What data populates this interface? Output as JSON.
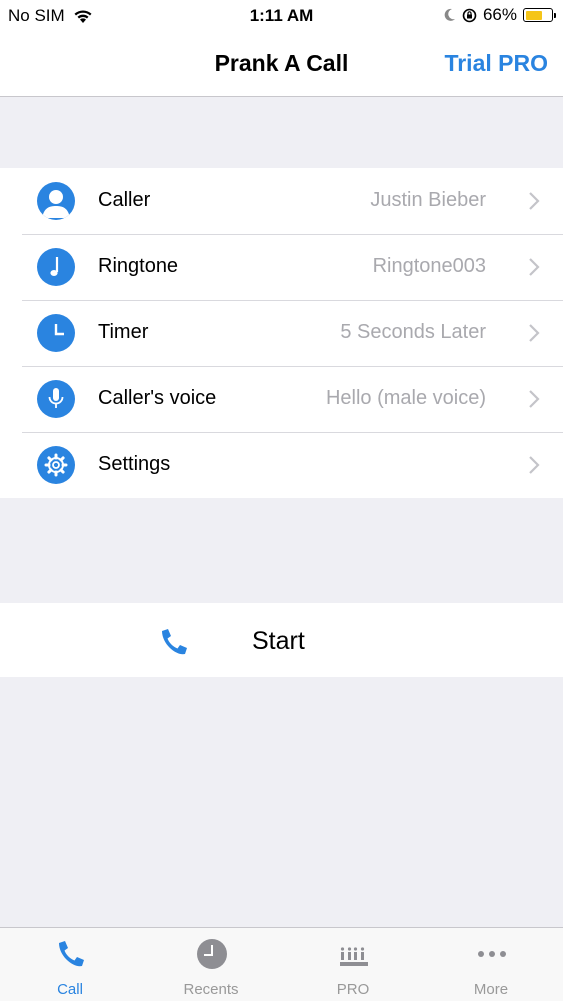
{
  "status_bar": {
    "carrier": "No SIM",
    "time": "1:11 AM",
    "battery_percent": "66%",
    "battery_level": 0.66,
    "battery_color": "#f5c518"
  },
  "nav": {
    "title": "Prank A Call",
    "right_button": "Trial PRO"
  },
  "accent_color": "#2a84e0",
  "menu": {
    "items": [
      {
        "icon": "person-icon",
        "label": "Caller",
        "value": "Justin Bieber"
      },
      {
        "icon": "music-note-icon",
        "label": "Ringtone",
        "value": "Ringtone003"
      },
      {
        "icon": "clock-icon",
        "label": "Timer",
        "value": "5 Seconds Later"
      },
      {
        "icon": "microphone-icon",
        "label": "Caller's voice",
        "value": "Hello (male voice)"
      },
      {
        "icon": "gear-icon",
        "label": "Settings",
        "value": ""
      }
    ]
  },
  "start": {
    "icon": "phone-icon",
    "label": "Start"
  },
  "tabbar": {
    "tabs": [
      {
        "icon": "phone-icon",
        "label": "Call",
        "active": true
      },
      {
        "icon": "clock-icon",
        "label": "Recents",
        "active": false
      },
      {
        "icon": "crown-icon",
        "label": "PRO",
        "active": false
      },
      {
        "icon": "more-dots-icon",
        "label": "More",
        "active": false
      }
    ]
  }
}
